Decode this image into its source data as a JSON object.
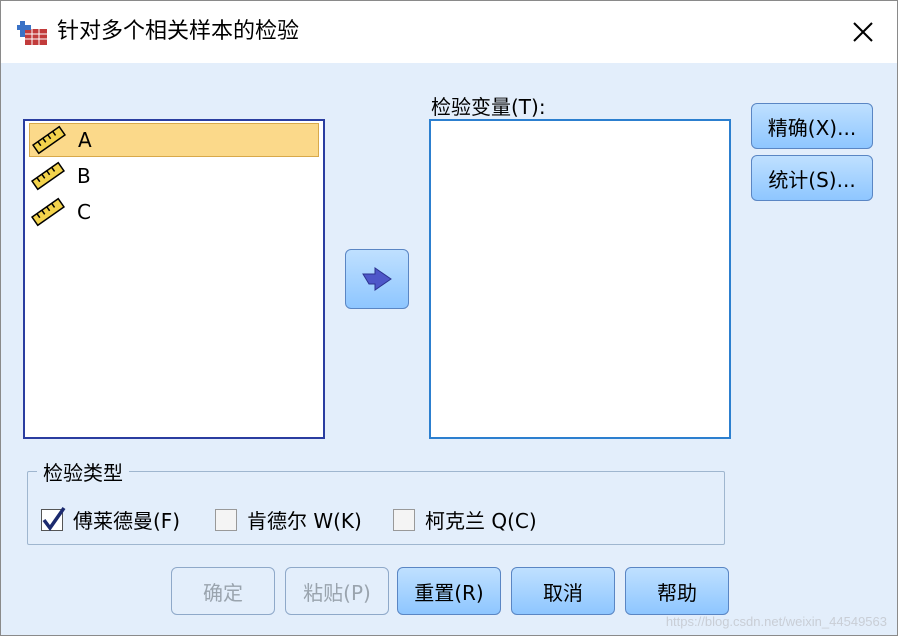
{
  "window": {
    "title": "针对多个相关样本的检验",
    "close_glyph": "✕"
  },
  "source_list": {
    "items": [
      {
        "label": "A",
        "icon": "scale-ruler-icon",
        "selected": true
      },
      {
        "label": "B",
        "icon": "scale-ruler-icon",
        "selected": false
      },
      {
        "label": "C",
        "icon": "scale-ruler-icon",
        "selected": false
      }
    ]
  },
  "test_variables": {
    "label": "检验变量(T):"
  },
  "side_buttons": {
    "exact": "精确(X)...",
    "statistics": "统计(S)..."
  },
  "test_type": {
    "legend": "检验类型",
    "options": [
      {
        "label": "傅莱德曼(F)",
        "checked": true
      },
      {
        "label": "肯德尔 W(K)",
        "checked": false
      },
      {
        "label": "柯克兰 Q(C)",
        "checked": false
      }
    ]
  },
  "bottom_buttons": {
    "ok": "确定",
    "paste": "粘贴(P)",
    "reset": "重置(R)",
    "cancel": "取消",
    "help": "帮助"
  },
  "watermark": "https://blog.csdn.net/weixin_44549563",
  "colors": {
    "dialog_bg": "#e3eefb",
    "button_fill": "#8ec6ff",
    "selection": "#fbd98a",
    "list_border": "#2a3da0"
  }
}
